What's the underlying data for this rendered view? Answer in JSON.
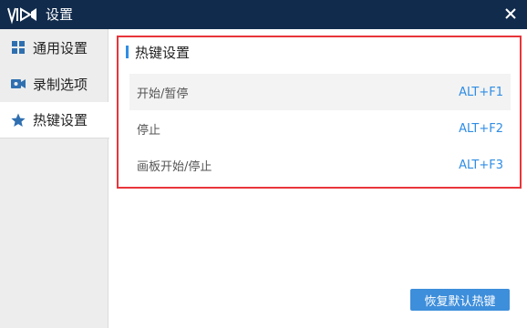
{
  "window": {
    "title": "设置",
    "close_icon": "close-icon",
    "app_icon": "video-recorder-icon"
  },
  "colors": {
    "titlebar": "#112b4c",
    "accent": "#2f8de4",
    "highlight_border": "#e8353b",
    "button": "#3d8edb"
  },
  "sidebar": {
    "items": [
      {
        "label": "通用设置",
        "icon": "grid-icon",
        "active": false
      },
      {
        "label": "录制选项",
        "icon": "camera-icon",
        "active": false
      },
      {
        "label": "热键设置",
        "icon": "star-icon",
        "active": true
      }
    ]
  },
  "hotkeys": {
    "section_title": "热键设置",
    "rows": [
      {
        "label": "开始/暂停",
        "key": "ALT+F1"
      },
      {
        "label": "停止",
        "key": "ALT+F2"
      },
      {
        "label": "画板开始/停止",
        "key": "ALT+F3"
      }
    ]
  },
  "restore_button": "恢复默认热键"
}
